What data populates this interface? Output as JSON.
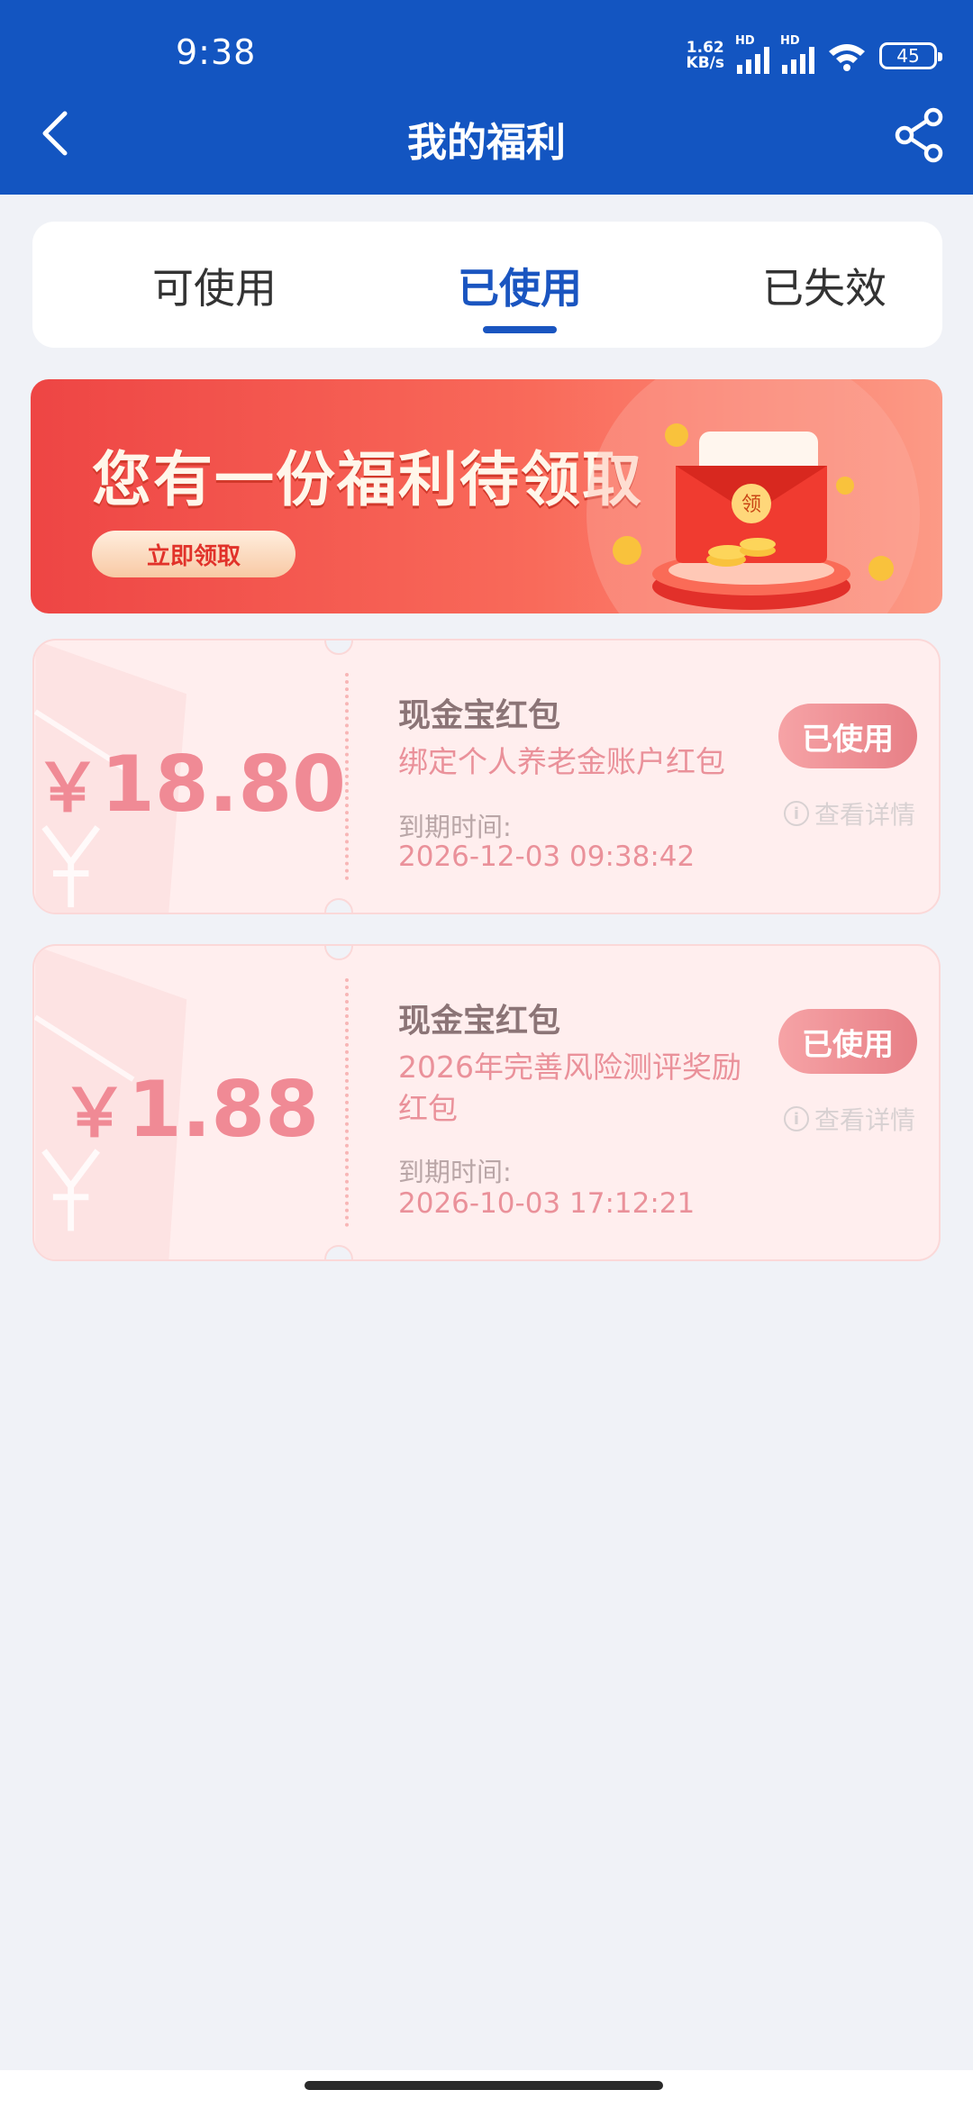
{
  "status_bar": {
    "time": "9:38",
    "speed_top": "1.62",
    "speed_bottom": "KB/s",
    "hd1": "HD",
    "hd2": "HD",
    "battery": "45",
    "icons": [
      "signal-icon",
      "signal-icon",
      "wifi-icon",
      "battery-icon"
    ]
  },
  "nav": {
    "title": "我的福利",
    "back_icon": "chevron-left-icon",
    "share_icon": "share-icon"
  },
  "tabs": [
    {
      "label": "可使用",
      "active": false
    },
    {
      "label": "已使用",
      "active": true
    },
    {
      "label": "已失效",
      "active": false
    }
  ],
  "banner": {
    "title": "您有一份福利待领取",
    "button": "立即领取",
    "envelope_char": "领"
  },
  "coupons": [
    {
      "currency": "￥",
      "amount": "18.80",
      "title": "现金宝红包",
      "desc": "绑定个人养老金账户红包",
      "expiry_label": "到期时间:",
      "expiry_value": "2026-12-03 09:38:42",
      "status": "已使用",
      "detail": "查看详情"
    },
    {
      "currency": "￥",
      "amount": "1.88",
      "title": "现金宝红包",
      "desc": "2026年完善风险测评奖励红包",
      "expiry_label": "到期时间:",
      "expiry_value": "2026-10-03 17:12:21",
      "status": "已使用",
      "detail": "查看详情"
    }
  ],
  "colors": {
    "header": "#1355c1",
    "tab_active": "#1a55c0",
    "background": "#f0f2f7",
    "coupon_bg": "#ffeeee",
    "amount": "#f08a95"
  }
}
